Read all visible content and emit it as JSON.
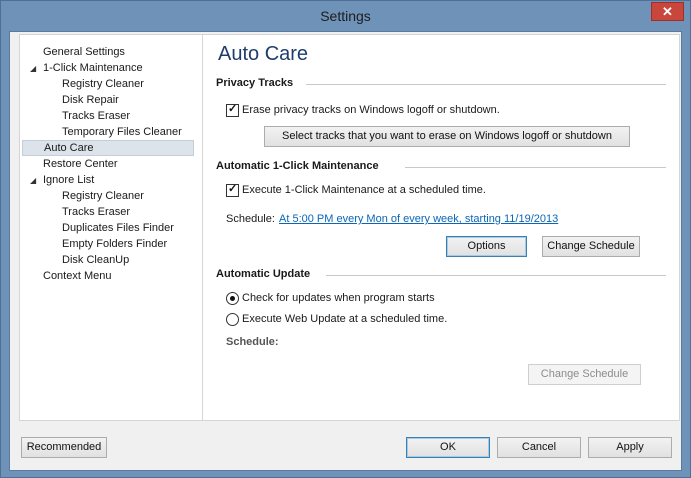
{
  "window": {
    "title": "Settings",
    "close_glyph": "✕"
  },
  "tree": {
    "items": [
      {
        "label": "General Settings"
      },
      {
        "label": "1-Click Maintenance"
      },
      {
        "label": "Registry Cleaner"
      },
      {
        "label": "Disk Repair"
      },
      {
        "label": "Tracks Eraser"
      },
      {
        "label": "Temporary Files Cleaner"
      },
      {
        "label": "Auto Care"
      },
      {
        "label": "Restore Center"
      },
      {
        "label": "Ignore List"
      },
      {
        "label": "Registry Cleaner"
      },
      {
        "label": "Tracks Eraser"
      },
      {
        "label": "Duplicates Files Finder"
      },
      {
        "label": "Empty Folders Finder"
      },
      {
        "label": "Disk CleanUp"
      },
      {
        "label": "Context Menu"
      }
    ]
  },
  "page": {
    "title": "Auto Care",
    "privacy": {
      "heading": "Privacy Tracks",
      "erase_label": "Erase privacy tracks on Windows logoff or shutdown.",
      "erase_checked": true,
      "select_button": "Select tracks that you want to erase on Windows logoff or shutdown"
    },
    "maintenance": {
      "heading": "Automatic 1-Click Maintenance",
      "execute_label": "Execute 1-Click Maintenance at a scheduled time.",
      "execute_checked": true,
      "schedule_label": "Schedule:",
      "schedule_value": "At 5:00 PM every Mon of every week, starting 11/19/2013",
      "options_button": "Options",
      "change_button": "Change Schedule"
    },
    "update": {
      "heading": "Automatic Update",
      "option_startup": "Check for updates when program starts",
      "option_scheduled": "Execute Web Update at a scheduled time.",
      "selected": "startup",
      "schedule_label": "Schedule:",
      "change_button": "Change Schedule"
    }
  },
  "footer": {
    "recommended": "Recommended",
    "ok": "OK",
    "cancel": "Cancel",
    "apply": "Apply"
  },
  "colors": {
    "frame": "#6f92b9",
    "close": "#c9463d",
    "title_text": "#1e3d6e",
    "link": "#0a66b7",
    "selection": "#dde3ea"
  }
}
